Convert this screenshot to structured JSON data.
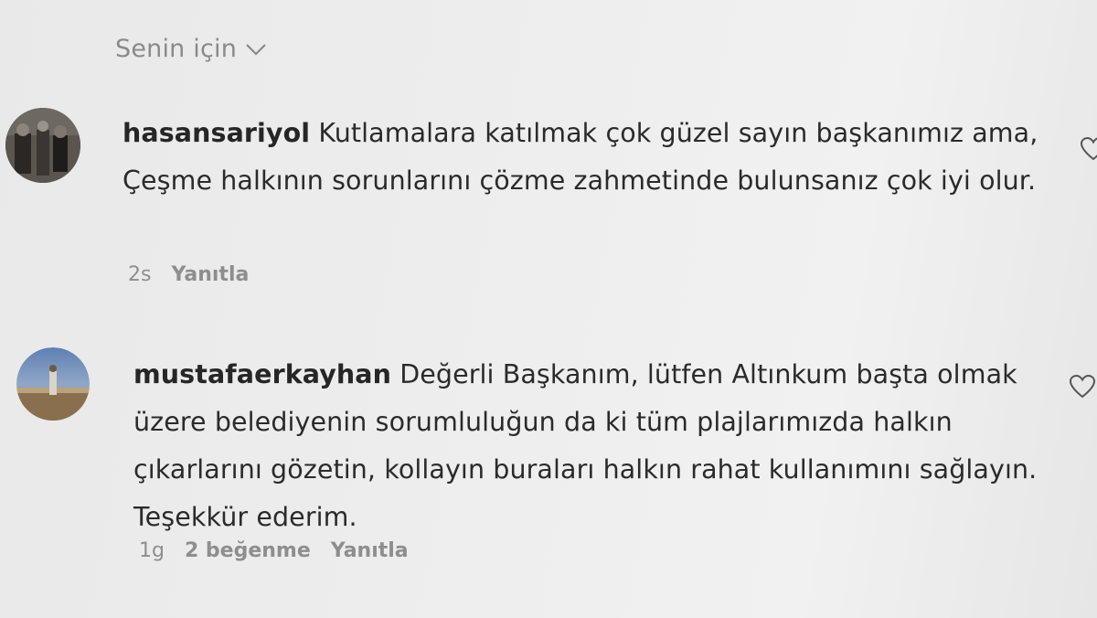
{
  "sort": {
    "label": "Senin için",
    "icon": "chevron-down-icon"
  },
  "comments": [
    {
      "username": "hasansariyol",
      "text": "Kutlamalara katılmak çok güzel sayın başkanımız ama, Çeşme halkının sorunlarını çözme zahmetinde bulunsanız çok iyi olur.",
      "time": "2s",
      "reply_label": "Yanıtla",
      "like_icon": "heart-icon"
    },
    {
      "username": "mustafaerkayhan",
      "text": "Değerli Başkanım, lütfen Altınkum başta olmak üzere belediyenin sorumluluğun da ki tüm plajlarımızda halkın çıkarlarını gözetin, kollayın buraları halkın rahat kullanımını sağlayın. Teşekkür ederim.",
      "time": "1g",
      "likes": "2 beğenme",
      "reply_label": "Yanıtla",
      "like_icon": "heart-icon"
    }
  ]
}
